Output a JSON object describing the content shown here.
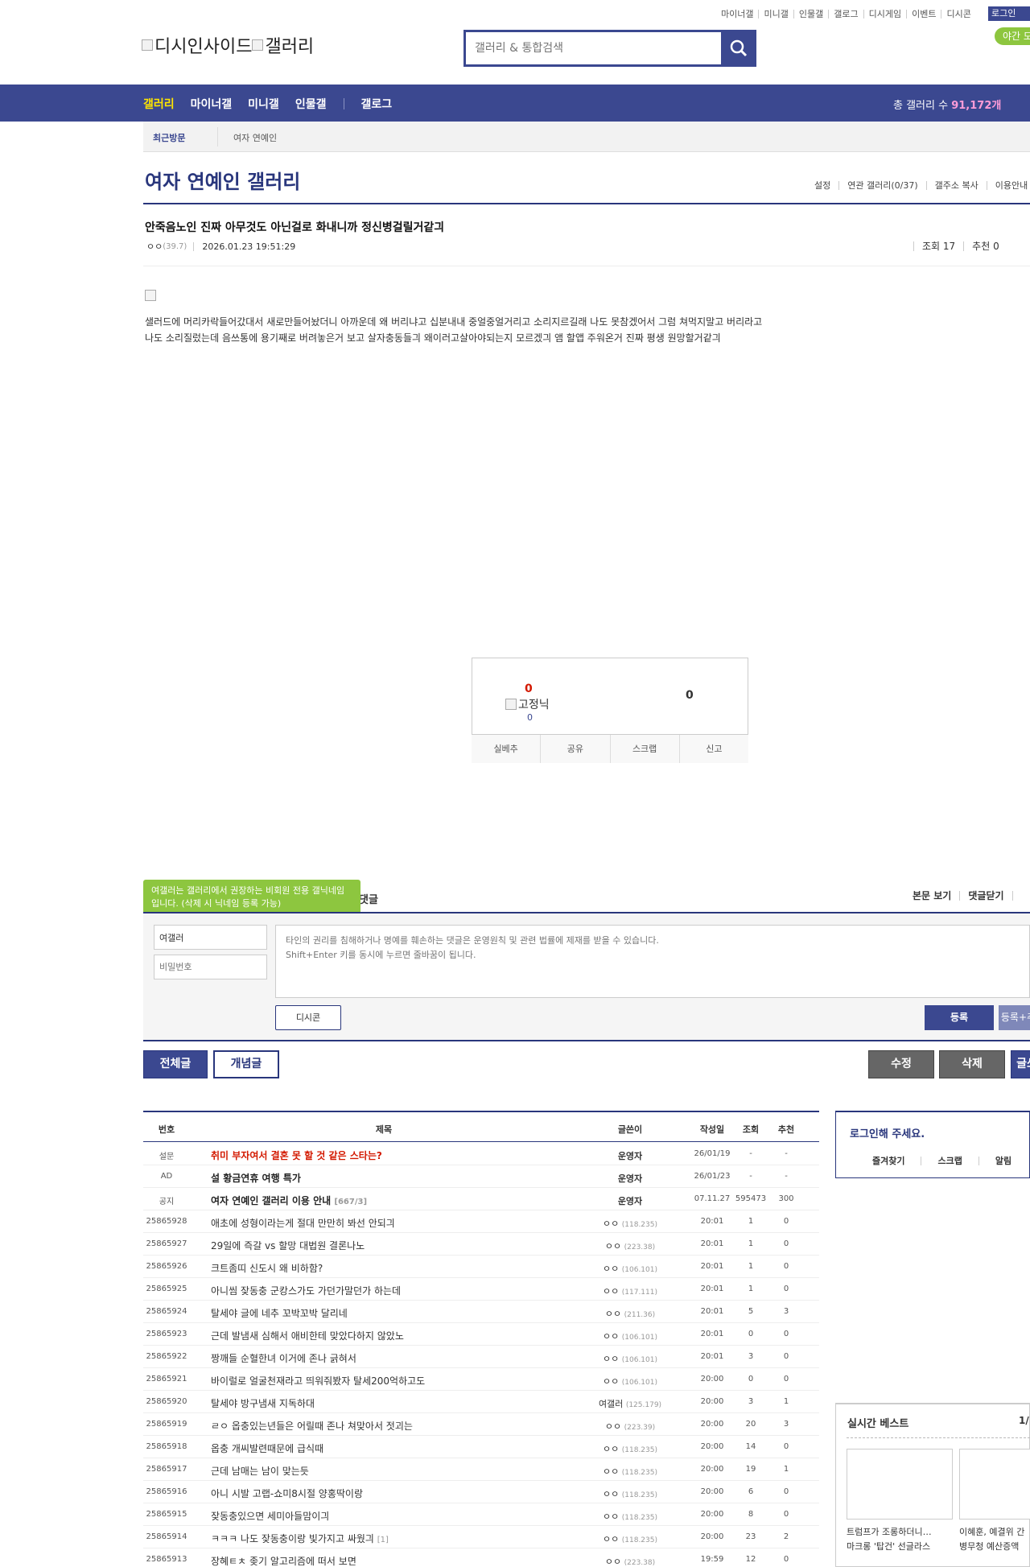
{
  "top_links": [
    "마이너갤",
    "미니갤",
    "인물갤",
    "갤로그",
    "디시게임",
    "이벤트",
    "디시콘"
  ],
  "login_label": "로그인",
  "night_mode_label": "야간 모드",
  "logo_text_1": "디시인사이드",
  "logo_text_2": "갤러리",
  "search": {
    "placeholder": "갤러리 & 통합검색"
  },
  "nav": {
    "items": [
      "갤러리",
      "마이너갤",
      "미니갤",
      "인물갤"
    ],
    "gallog": "갤로그",
    "total_label": "총 갤러리 수",
    "total_value": "91,172개"
  },
  "recent": {
    "label": "최근방문",
    "item": "여자 연예인"
  },
  "gallery": {
    "title": "여자 연예인 갤러리",
    "menu": [
      "설정",
      "연관 갤러리(0/37)",
      "갤주소 복사",
      "이용안내"
    ]
  },
  "post": {
    "title": "안죽음노인 진짜 아무것도 아닌걸로 화내니까 정신병걸릴거같긔",
    "author": "ㅇㅇ",
    "author_ip": "(39.7)",
    "date": "2026.01.23 19:51:29",
    "views": "조회 17",
    "recommends": "추천 0",
    "body_line1": "샐러드에 머리카락들어갔대서 새로만들어놨더니 아까운데 왜 버리냐고 십분내내 중얼중얼거리고 소리지르길래 나도 못참겠어서 그럼 쳐먹지말고 버리라고",
    "body_line2": "나도 소리질렀는데 음쓰통에 용기째로 버려놓은거 보고 살자충동들긔 왜이러고살아야되는지 모르겠긔 앰 할앱 주워온거 진짜 평생 원망할거같긔"
  },
  "vote": {
    "up": "0",
    "fixed_nick_label": "고정닉",
    "fixed_count": "0",
    "down": "0",
    "buttons": [
      "실베추",
      "공유",
      "스크랩",
      "신고"
    ]
  },
  "comments": {
    "tip": "여갤러는 갤러리에서 권장하는 비회원 전용 갤닉네임입니다. (삭제 시 닉네임 등록 가능)",
    "header_suffix": "댓글",
    "links": [
      "본문 보기",
      "댓글닫기",
      ""
    ],
    "nick_value": "여갤러",
    "pw_placeholder": "비밀번호",
    "textarea_placeholder": "타인의 권리를 침해하거나 명예를 훼손하는 댓글은 운영원칙 및 관련 법률에 제재를 받을 수 있습니다.\nShift+Enter 키를 동시에 누르면 줄바꿈이 됩니다.",
    "dccon_label": "디시콘",
    "submit_label": "등록",
    "submit2_label": "등록+추천"
  },
  "list_buttons": {
    "all": "전체글",
    "concept": "개념글",
    "edit": "수정",
    "delete": "삭제",
    "write": "글쓰기"
  },
  "list": {
    "headers": {
      "no": "번호",
      "subject": "제목",
      "writer": "글쓴이",
      "date": "작성일",
      "views": "조회",
      "recommend": "추천"
    },
    "rows": [
      {
        "no": "설문",
        "subject": "취미 부자여서 결혼 못 할 것 같은 스타는?",
        "rc": "",
        "writer": "운영자",
        "ip": "",
        "date": "26/01/19",
        "views": "-",
        "rec": "-",
        "kind": "survey"
      },
      {
        "no": "AD",
        "subject": "설 황금연휴 여행 특가",
        "rc": "",
        "writer": "운영자",
        "ip": "",
        "date": "26/01/23",
        "views": "-",
        "rec": "-",
        "kind": "notice"
      },
      {
        "no": "공지",
        "subject": "여자 연예인 갤러리 이용 안내",
        "rc": "[667/3]",
        "writer": "운영자",
        "ip": "",
        "date": "07.11.27",
        "views": "595473",
        "rec": "300",
        "kind": "notice"
      },
      {
        "no": "25865928",
        "subject": "애초에 성형이라는게 절대 만만히 봐선 안되긔",
        "rc": "",
        "writer": "ㅇㅇ",
        "ip": "(118.235)",
        "date": "20:01",
        "views": "1",
        "rec": "0",
        "kind": ""
      },
      {
        "no": "25865927",
        "subject": "29일에 즉갈 vs 할망 대법원 결론나노",
        "rc": "",
        "writer": "ㅇㅇ",
        "ip": "(223.38)",
        "date": "20:01",
        "views": "1",
        "rec": "0",
        "kind": ""
      },
      {
        "no": "25865926",
        "subject": "크트좀띠 신도시 왜 비하함?",
        "rc": "",
        "writer": "ㅇㅇ",
        "ip": "(106.101)",
        "date": "20:01",
        "views": "1",
        "rec": "0",
        "kind": ""
      },
      {
        "no": "25865925",
        "subject": "아니씸 잦동충 군캉스가도 가던가말던가 하는데",
        "rc": "",
        "writer": "ㅇㅇ",
        "ip": "(117.111)",
        "date": "20:01",
        "views": "1",
        "rec": "0",
        "kind": ""
      },
      {
        "no": "25865924",
        "subject": "탈세야 글에 네추 꼬박꼬박 달리네",
        "rc": "",
        "writer": "ㅇㅇ",
        "ip": "(211.36)",
        "date": "20:01",
        "views": "5",
        "rec": "3",
        "kind": ""
      },
      {
        "no": "25865923",
        "subject": "근데 발냄새 심해서 애비한테 맞았다하지 않았노",
        "rc": "",
        "writer": "ㅇㅇ",
        "ip": "(106.101)",
        "date": "20:01",
        "views": "0",
        "rec": "0",
        "kind": ""
      },
      {
        "no": "25865922",
        "subject": "짱깨들 순혈한녀 이거에 존나 긁혀서",
        "rc": "",
        "writer": "ㅇㅇ",
        "ip": "(106.101)",
        "date": "20:01",
        "views": "3",
        "rec": "0",
        "kind": ""
      },
      {
        "no": "25865921",
        "subject": "바이럴로 얼굴천재라고 띄워줘봤자 탈세200억하고도",
        "rc": "",
        "writer": "ㅇㅇ",
        "ip": "(106.101)",
        "date": "20:00",
        "views": "0",
        "rec": "0",
        "kind": ""
      },
      {
        "no": "25865920",
        "subject": "탈세야 방구냄새 지독하대",
        "rc": "",
        "writer": "여갤러",
        "ip": "(125.179)",
        "date": "20:00",
        "views": "3",
        "rec": "1",
        "kind": ""
      },
      {
        "no": "25865919",
        "subject": "ㄹㅇ 옵충있는년들은 어릴때 존나 쳐맞아서 젓괴는",
        "rc": "",
        "writer": "ㅇㅇ",
        "ip": "(223.39)",
        "date": "20:00",
        "views": "20",
        "rec": "3",
        "kind": ""
      },
      {
        "no": "25865918",
        "subject": "옵충 개씨발련때문에 급식때",
        "rc": "",
        "writer": "ㅇㅇ",
        "ip": "(118.235)",
        "date": "20:00",
        "views": "14",
        "rec": "0",
        "kind": ""
      },
      {
        "no": "25865917",
        "subject": "근데 남매는 남이 맞는듯",
        "rc": "",
        "writer": "ㅇㅇ",
        "ip": "(118.235)",
        "date": "20:00",
        "views": "19",
        "rec": "1",
        "kind": ""
      },
      {
        "no": "25865916",
        "subject": "아니 시발 고랩-쇼미8시절 양홍딱이랑",
        "rc": "",
        "writer": "ㅇㅇ",
        "ip": "(118.235)",
        "date": "20:00",
        "views": "6",
        "rec": "0",
        "kind": ""
      },
      {
        "no": "25865915",
        "subject": "잦동충있으면 세미아들맘이긔",
        "rc": "",
        "writer": "ㅇㅇ",
        "ip": "(118.235)",
        "date": "20:00",
        "views": "8",
        "rec": "0",
        "kind": ""
      },
      {
        "no": "25865914",
        "subject": "ㅋㅋㅋ 나도 잦동충이랑 빛가지고 싸웠긔",
        "rc": "[1]",
        "writer": "ㅇㅇ",
        "ip": "(118.235)",
        "date": "20:00",
        "views": "23",
        "rec": "2",
        "kind": ""
      },
      {
        "no": "25865913",
        "subject": "장혜ㅌㅊ 좆기 알고리즘에 떠서 보면",
        "rc": "",
        "writer": "ㅇㅇ",
        "ip": "(223.38)",
        "date": "19:59",
        "views": "12",
        "rec": "0",
        "kind": ""
      }
    ]
  },
  "sidebar": {
    "login_text": "로그인해 주세요.",
    "login_links": [
      "즐겨찾기",
      "스크랩",
      "알림"
    ],
    "best_title": "실시간 베스트",
    "best_page": "1/",
    "best_captions": [
      {
        "line1": "트럼프가 조롱하더니…",
        "line2": "마크롱 '탑건' 선글라스"
      },
      {
        "line1": "이혜훈, 예결위 간",
        "line2": "병무청 예산증액"
      }
    ]
  }
}
